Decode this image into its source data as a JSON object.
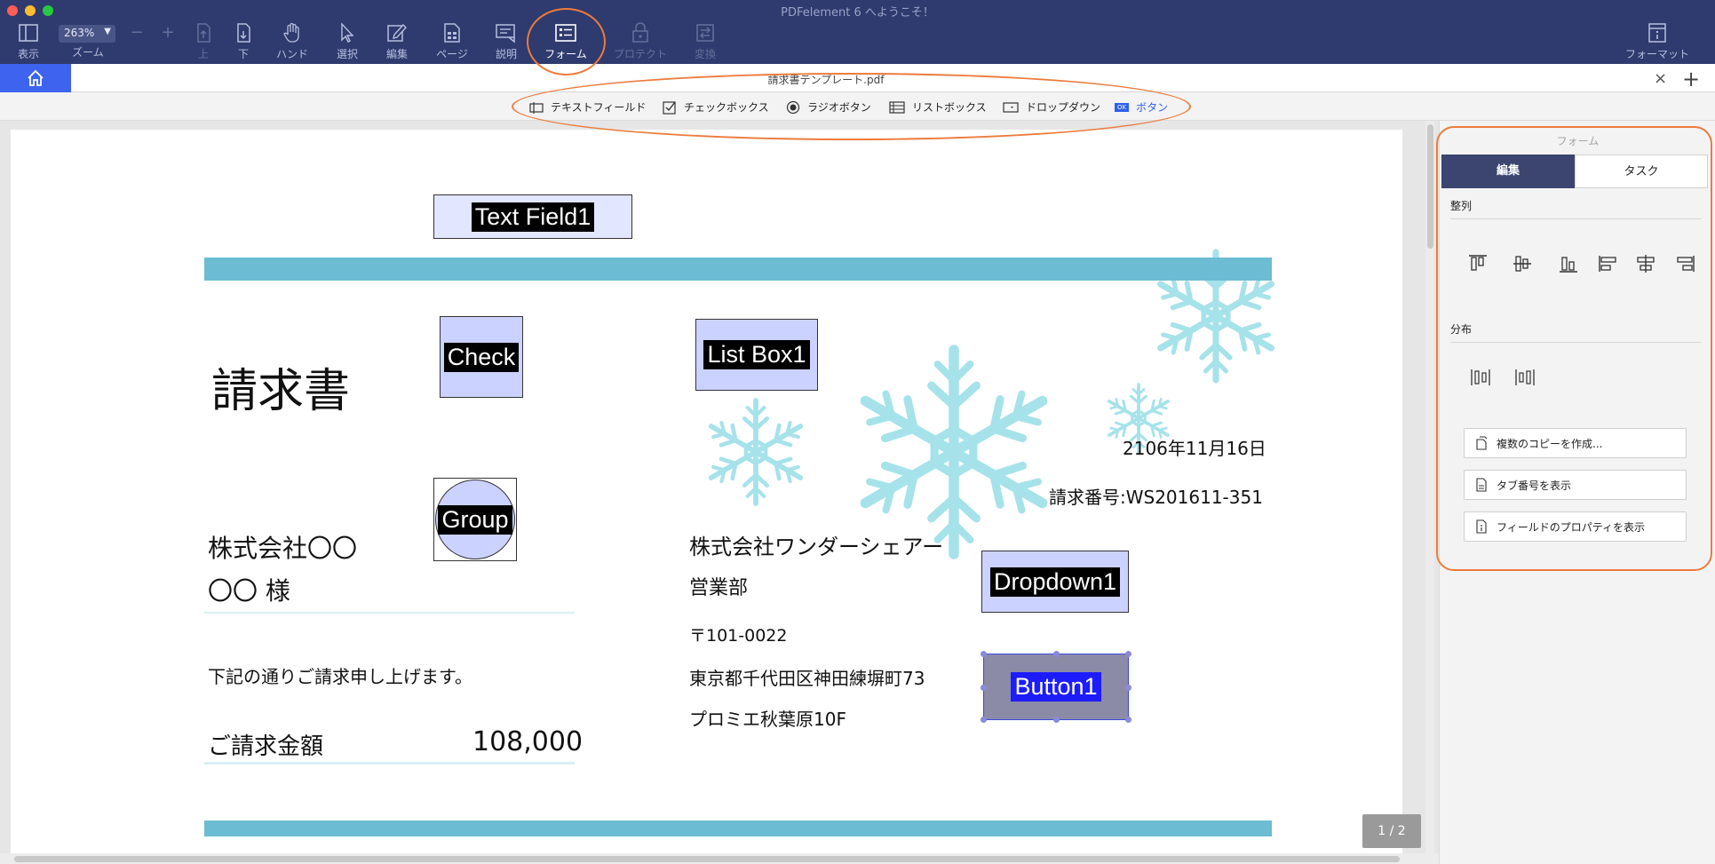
{
  "app": {
    "title": "PDFelement 6 へようこそ！"
  },
  "toolbar": {
    "zoom_value": "263%",
    "zoom_minus": "−",
    "zoom_plus": "+",
    "items": [
      {
        "label": "表示",
        "icon": "sidebar-icon"
      },
      {
        "label": "ズーム",
        "icon": "zoom-select"
      },
      {
        "label": "上",
        "icon": "page-up-icon",
        "disabled": true
      },
      {
        "label": "下",
        "icon": "page-down-icon"
      },
      {
        "label": "ハンド",
        "icon": "hand-icon"
      },
      {
        "label": "選択",
        "icon": "cursor-icon"
      },
      {
        "label": "編集",
        "icon": "edit-icon"
      },
      {
        "label": "ページ",
        "icon": "page-icon"
      },
      {
        "label": "説明",
        "icon": "comment-icon"
      },
      {
        "label": "フォーム",
        "icon": "form-icon",
        "active": true
      },
      {
        "label": "プロテクト",
        "icon": "lock-icon"
      },
      {
        "label": "変換",
        "icon": "convert-icon"
      },
      {
        "label": "フォーマット",
        "icon": "format-icon"
      }
    ]
  },
  "tabs": {
    "document_title": "請求書テンプレート.pdf",
    "close": "×",
    "add": "+"
  },
  "form_toolbar": {
    "items": [
      {
        "label": "テキストフィールド",
        "icon": "text-field-icon"
      },
      {
        "label": "チェックボックス",
        "icon": "checkbox-icon"
      },
      {
        "label": "ラジオボタン",
        "icon": "radio-icon"
      },
      {
        "label": "リストボックス",
        "icon": "listbox-icon"
      },
      {
        "label": "ドロップダウン",
        "icon": "dropdown-icon"
      },
      {
        "label": "ボタン",
        "icon": "button-icon",
        "badge": "OK"
      }
    ]
  },
  "document": {
    "heading": "請求書",
    "customer_company": "株式会社〇〇",
    "customer_name": "〇〇 様",
    "intro": "下記の通りご請求申し上げます。",
    "amount_label": "ご請求金額",
    "amount_value": "108,000",
    "date": "2106年11月16日",
    "invoice_number": "請求番号:WS201611-351",
    "sender_company": "株式会社ワンダーシェアー",
    "department": "営業部",
    "postal_code": "〒101-0022",
    "address": "東京都千代田区神田練塀町73",
    "building": "プロミエ秋葉原10F",
    "fields": {
      "text_field": "Text Field1",
      "check": "Check",
      "list_box": "List Box1",
      "group": "Group",
      "dropdown": "Dropdown1",
      "button": "Button1"
    }
  },
  "pager": {
    "label": "1 / 2"
  },
  "right_panel": {
    "title": "フォーム",
    "tab_edit": "編集",
    "tab_task": "タスク",
    "align_title": "整列",
    "distribute_title": "分布",
    "buttons": {
      "copies": "複数のコピーを作成...",
      "tab_order": "タブ番号を表示",
      "properties": "フィールドのプロパティを表示"
    }
  },
  "colors": {
    "toolbar_bg": "#2f3a6e",
    "accent": "#3d63ef",
    "annotation": "#ec7b3c",
    "band": "#6cbcd3",
    "snowflake": "#a6e2ea"
  }
}
